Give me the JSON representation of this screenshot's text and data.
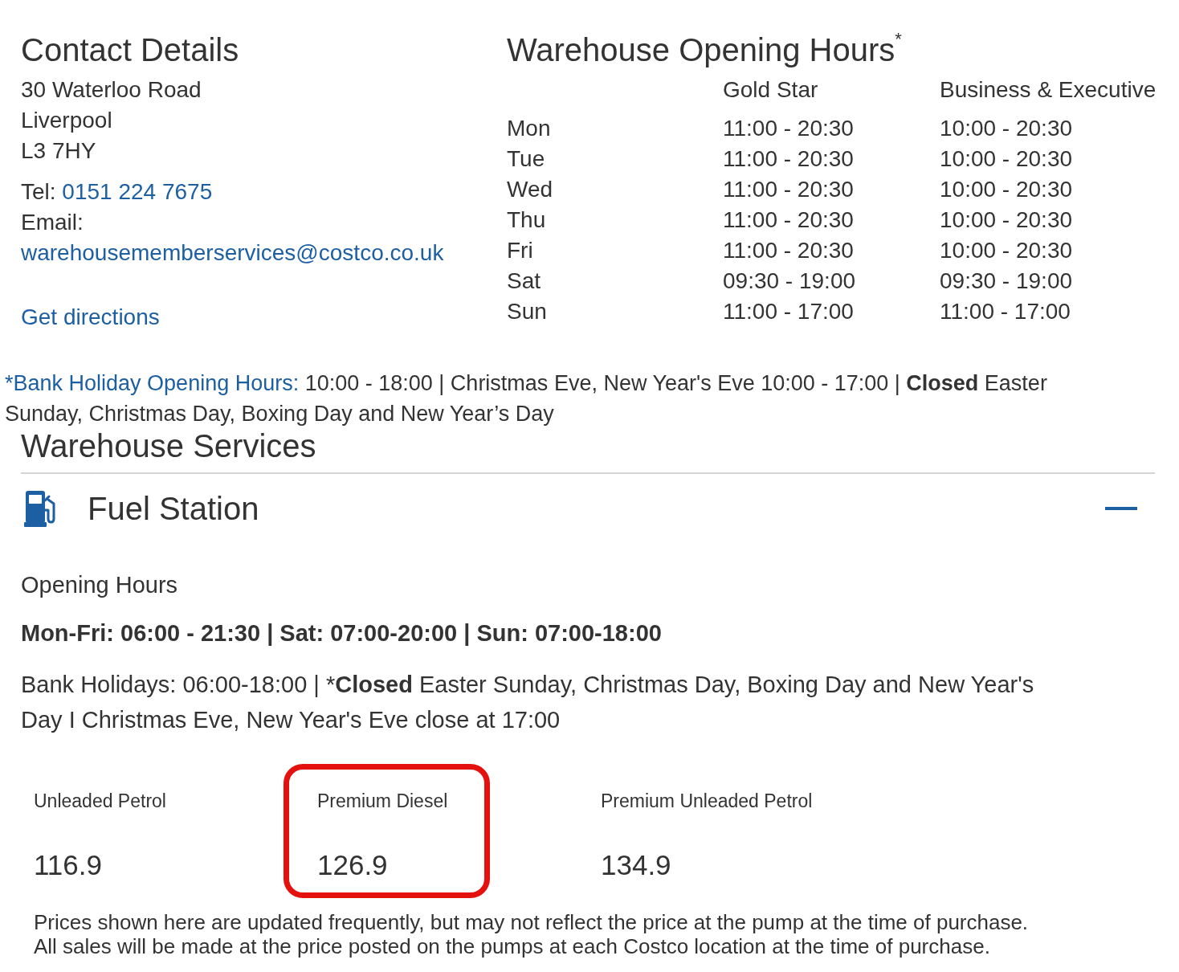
{
  "contact": {
    "title": "Contact Details",
    "address": [
      "30 Waterloo Road",
      "Liverpool",
      "L3 7HY"
    ],
    "tel_label": "Tel:",
    "tel": "0151 224 7675",
    "email_label": "Email:",
    "email": "warehousememberservices@costco.co.uk",
    "directions": "Get directions"
  },
  "opening_hours": {
    "title": "Warehouse Opening Hours$^{*}$",
    "columns": [
      "Gold Star",
      "Business & Executive"
    ],
    "rows": [
      {
        "day": "Mon",
        "hours": [
          "11:00 - 20:30",
          "10:00 - 20:30"
        ]
      },
      {
        "day": "Tue",
        "hours": [
          "11:00 - 20:30",
          "10:00 - 20:30"
        ]
      },
      {
        "day": "Wed",
        "hours": [
          "11:00 - 20:30",
          "10:00 - 20:30"
        ]
      },
      {
        "day": "Thu",
        "hours": [
          "11:00 - 20:30",
          "10:00 - 20:30"
        ]
      },
      {
        "day": "Fri",
        "hours": [
          "11:00 - 20:30",
          "10:00 - 20:30"
        ]
      },
      {
        "day": "Sat",
        "hours": [
          "09:30 - 19:00",
          "09:30 - 19:00"
        ]
      },
      {
        "day": "Sun",
        "hours": [
          "11:00 - 17:00",
          "11:00 - 17:00"
        ]
      }
    ]
  },
  "bank_holiday_note": {
    "link": "*Bank Holiday Opening Hours:",
    "text": "10:00 - 18:00 | Christmas Eve, New Year's Eve 10:00 - 17:00 | **Closed** Easter Sunday, Christmas Day, Boxing Day and New Year’s Day"
  },
  "services": {
    "title": "Warehouse Services",
    "sections": [
      {
        "title": "Fuel Station",
        "expanded": true,
        "hours_title": "Opening Hours",
        "hours": "Mon-Fri: 06:00 - 21:30 | Sat: 07:00-20:00 | Sun: 07:00-18:00",
        "holidays": [
          {
            "text": "Bank Holidays: 06:00-18:00 | *",
            "bold": false
          },
          {
            "text": "Closed",
            "bold": true
          },
          {
            "text": " Easter Sunday, Christmas Day, Boxing Day and New Year's Day I Christmas Eve, New Year's Eve close at 17:00",
            "bold": false
          }
        ],
        "prices": [
          {
            "label": "Unleaded Petrol",
            "price": "116.9",
            "highlighted": false
          },
          {
            "label": "Premium Diesel",
            "price": "126.9",
            "highlighted": true
          },
          {
            "label": "Premium Unleaded Petrol",
            "price": "134.9",
            "highlighted": false
          }
        ],
        "disclaimer": [
          "Prices shown here are updated frequently, but may not reflect the price at the pump at the time of purchase.",
          "All sales will be made at the price posted on the pumps at each Costco location at the time of purchase."
        ]
      }
    ]
  }
}
